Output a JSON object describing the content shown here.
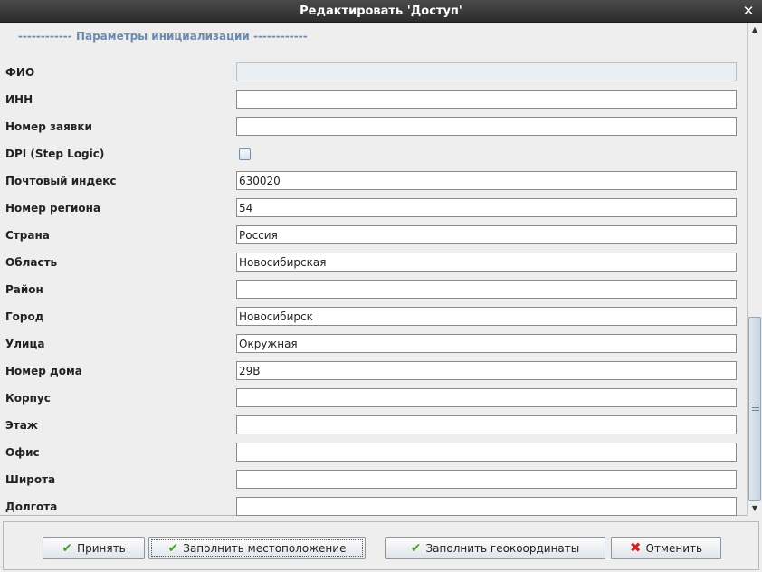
{
  "window": {
    "title": "Редактировать 'Доступ'"
  },
  "form": {
    "section_header": "------------ Параметры инициализации ------------",
    "fields": [
      {
        "label": "ФИО",
        "value": "",
        "type": "text",
        "disabled": true
      },
      {
        "label": "ИНН",
        "value": "",
        "type": "text"
      },
      {
        "label": "Номер заявки",
        "value": "",
        "type": "text"
      },
      {
        "label": "DPI (Step Logic)",
        "value": "",
        "type": "checkbox",
        "checked": false
      },
      {
        "label": "Почтовый индекс",
        "value": "630020",
        "type": "text"
      },
      {
        "label": "Номер региона",
        "value": "54",
        "type": "text"
      },
      {
        "label": "Страна",
        "value": "Россия",
        "type": "text"
      },
      {
        "label": "Область",
        "value": "Новосибирская",
        "type": "text"
      },
      {
        "label": "Район",
        "value": "",
        "type": "text"
      },
      {
        "label": "Город",
        "value": "Новосибирск",
        "type": "text"
      },
      {
        "label": "Улица",
        "value": "Окружная",
        "type": "text"
      },
      {
        "label": "Номер дома",
        "value": "29В",
        "type": "text"
      },
      {
        "label": "Корпус",
        "value": "",
        "type": "text"
      },
      {
        "label": "Этаж",
        "value": "",
        "type": "text"
      },
      {
        "label": "Офис",
        "value": "",
        "type": "text"
      },
      {
        "label": "Широта",
        "value": "",
        "type": "text"
      },
      {
        "label": "Долгота",
        "value": "",
        "type": "text"
      }
    ]
  },
  "buttons": {
    "accept": "Принять",
    "fill_location": "Заполнить местоположение",
    "fill_geo": "Заполнить геокоординаты",
    "cancel": "Отменить"
  },
  "icons": {
    "accept": "check-icon",
    "fill_location": "check-icon",
    "fill_geo": "check-icon",
    "cancel": "cross-icon"
  },
  "colors": {
    "titlebar": "#2c2c2c",
    "section_header": "#6d8aae",
    "check": "#4aa02c",
    "cross": "#d02020"
  },
  "scrollbar": {
    "position": 0.6
  }
}
